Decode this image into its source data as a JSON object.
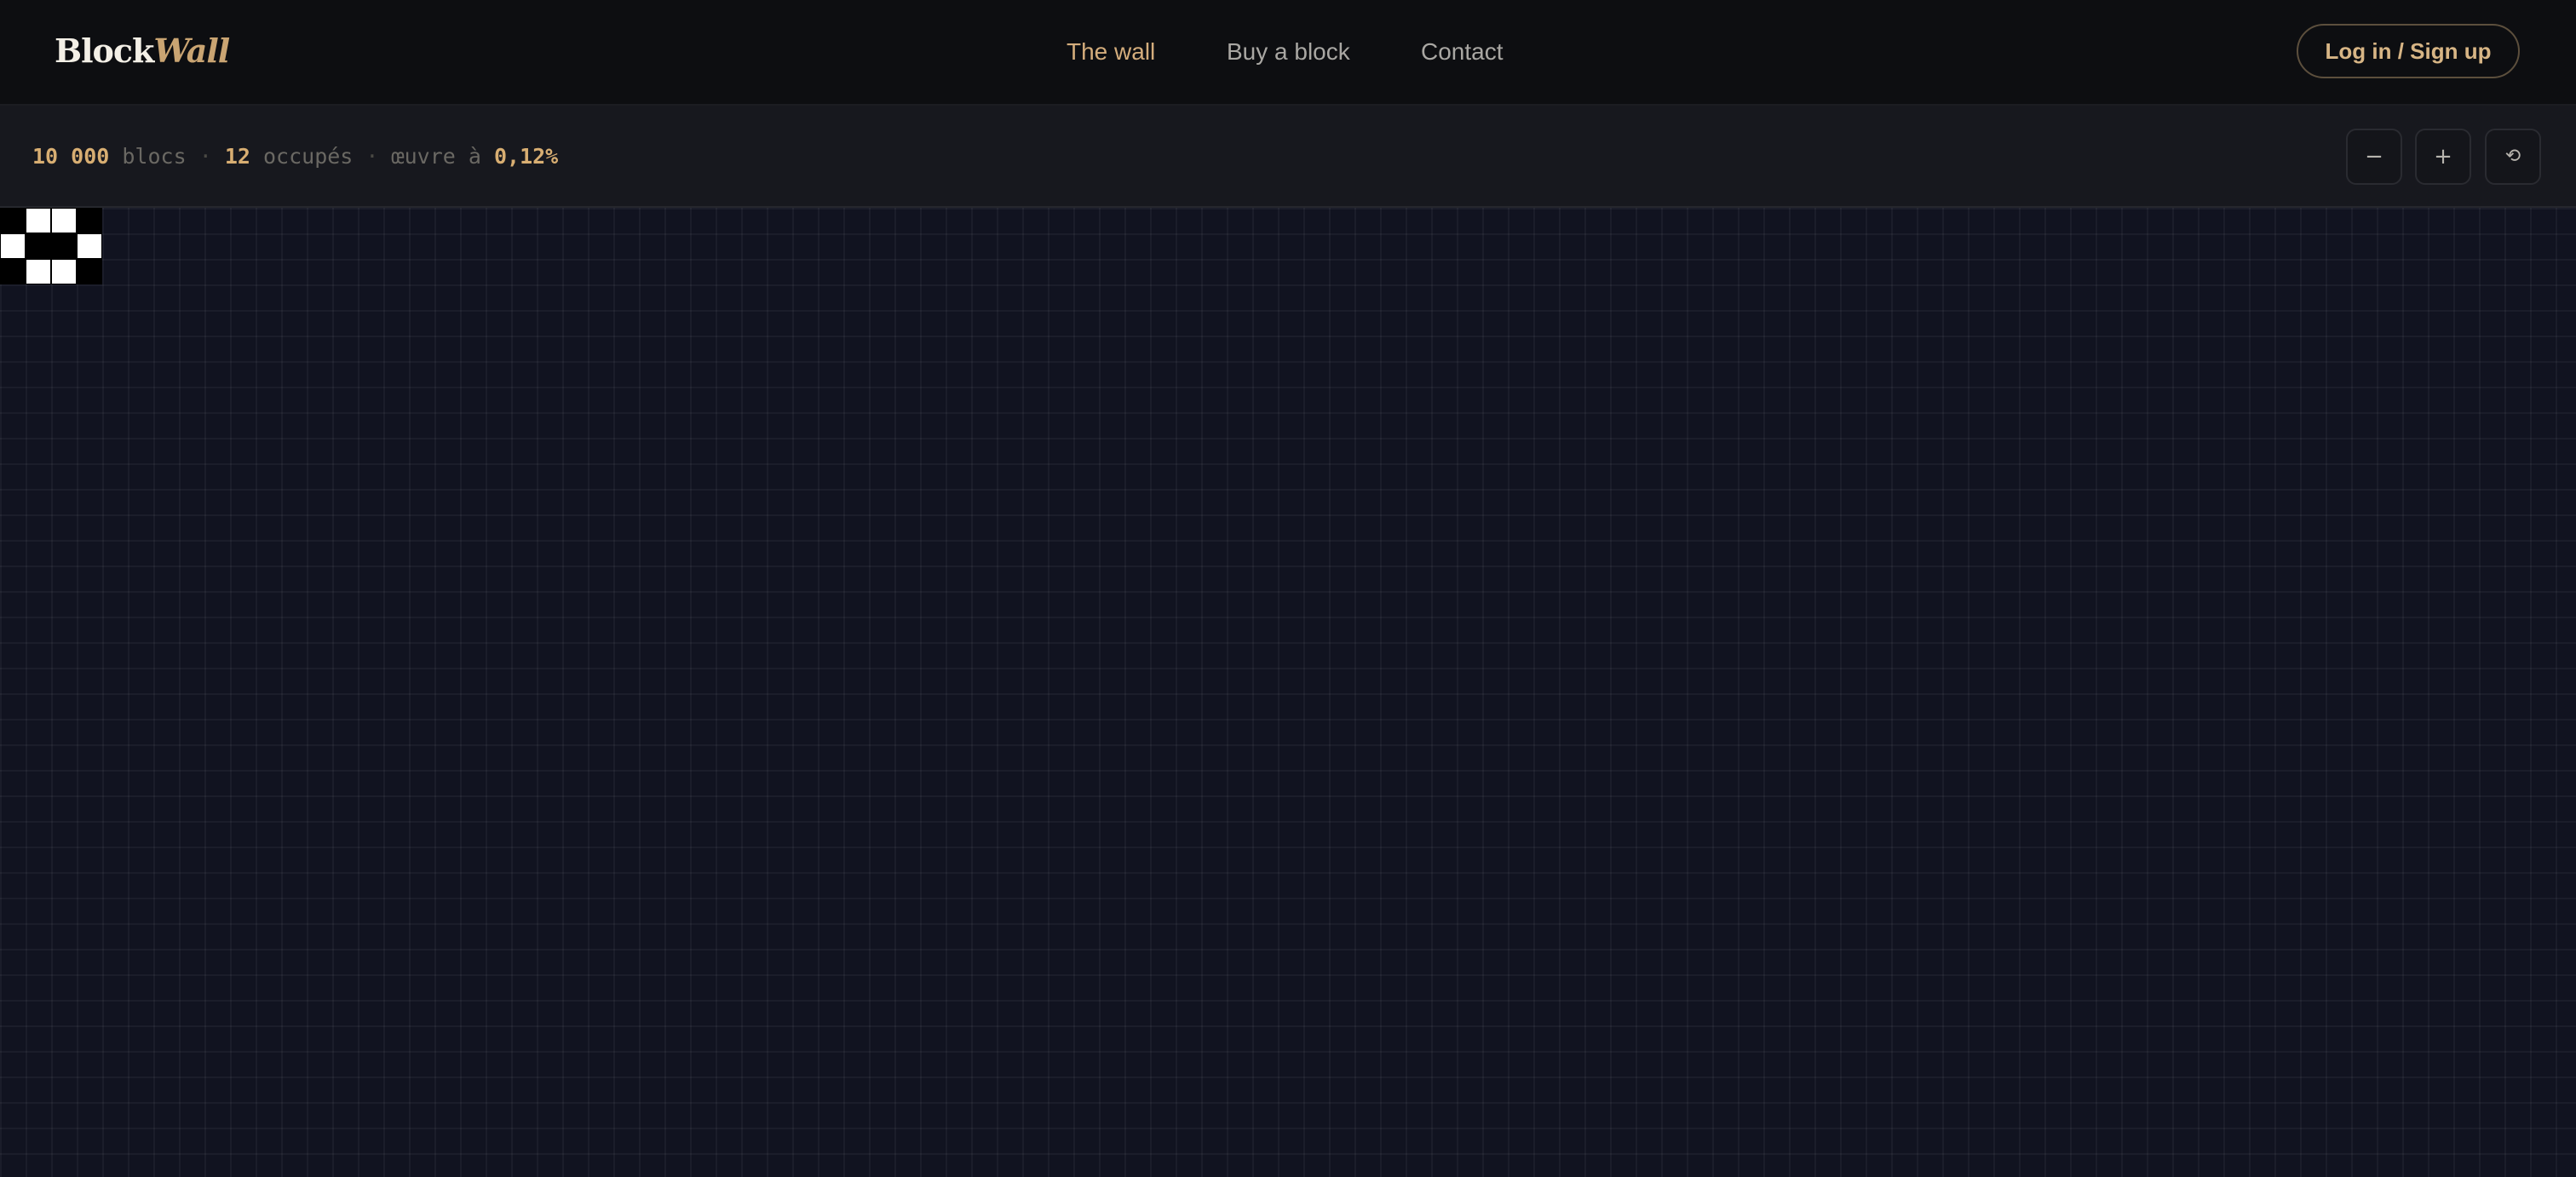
{
  "brand": {
    "part1": "Block",
    "part2": "Wall",
    "colors": {
      "light": "#f3efe6",
      "gold": "#c9a472"
    }
  },
  "nav": {
    "items": [
      {
        "label": "The wall",
        "active": true
      },
      {
        "label": "Buy a block",
        "active": false
      },
      {
        "label": "Contact",
        "active": false
      }
    ]
  },
  "auth": {
    "label": "Log in / Sign up"
  },
  "stats": {
    "total": "10 000",
    "total_label": "blocs",
    "occupied": "12",
    "occupied_label": "occupés",
    "progress_label": "œuvre à",
    "progress": "0,12%",
    "separator": "·"
  },
  "zoom": {
    "out_label": "−",
    "in_label": "+",
    "reset_label": "⟲"
  },
  "wall": {
    "pattern_rows": [
      [
        "black",
        "white",
        "white",
        "black"
      ],
      [
        "white",
        "black",
        "black",
        "white"
      ],
      [
        "black",
        "white",
        "white",
        "black"
      ]
    ],
    "colors": {
      "black": "#000000",
      "white": "#ffffff",
      "background": "#111320",
      "accent": "#d8ae72"
    }
  }
}
